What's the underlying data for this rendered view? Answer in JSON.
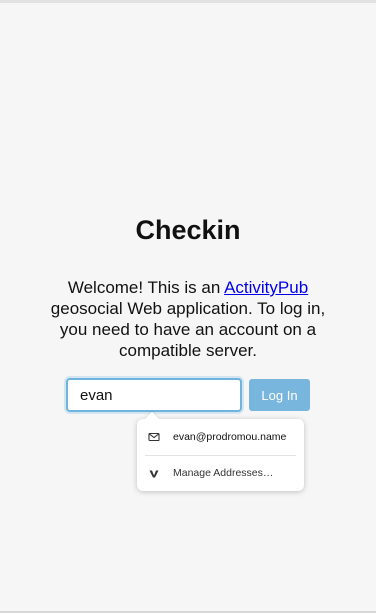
{
  "page": {
    "title": "Checkin",
    "intro_before": "Welcome! This is an ",
    "intro_link": "ActivityPub",
    "intro_after": " geosocial Web application. To log in, you need to have an account on a compatible server."
  },
  "login": {
    "address_value": "evan",
    "button_label": "Log In"
  },
  "autofill": {
    "items": [
      {
        "icon": "envelope-icon",
        "label": "evan@prodromou.name"
      },
      {
        "icon": "manage-addresses-icon",
        "label": "Manage Addresses…"
      }
    ]
  },
  "colors": {
    "background": "#f6f6f6",
    "link": "#0000ee",
    "button": "#78b6dd",
    "input_focus_border": "#6fb3df"
  }
}
